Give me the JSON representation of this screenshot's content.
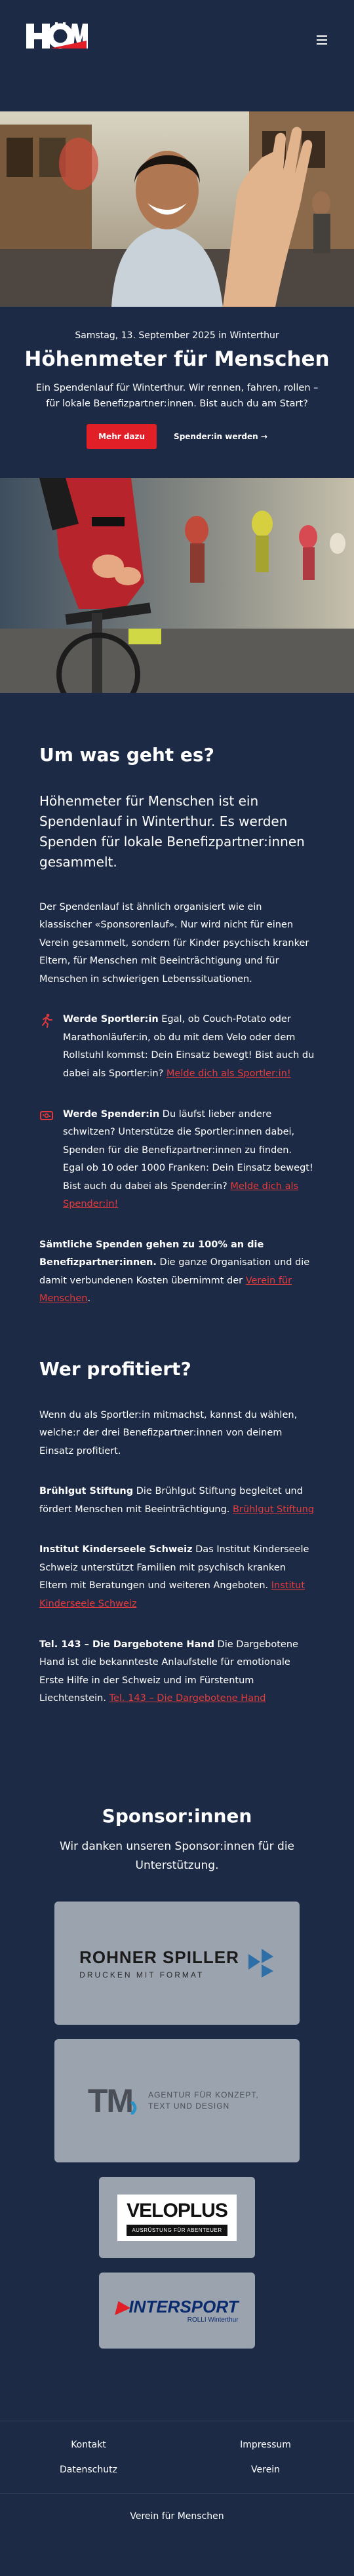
{
  "colors": {
    "background": "#1c2a45",
    "accent": "#e01f26",
    "card": "#9ba3ae"
  },
  "header": {
    "logo_text": "HÖM",
    "menu_icon": "hamburger-icon"
  },
  "hero": {
    "date": "Samstag, 13. September 2025 in Winterthur",
    "title": "Höhenmeter für Menschen",
    "subtitle": "Ein Spendenlauf für Winterthur. Wir rennen, fahren, rollen – für lokale Benefizpartner:innen. Bist auch du am Start?",
    "btn_more": "Mehr dazu",
    "btn_sponsor": "Spender:in werden →"
  },
  "about": {
    "title": "Um was geht es?",
    "lead": "Höhenmeter für Menschen ist ein Spendenlauf in Winterthur. Es werden Spenden für lokale Benefizpartner:innen gesammelt.",
    "text": "Der Spendenlauf ist ähnlich organisiert wie ein klassischer «Sponsorenlauf». Nur wird nicht für einen Verein gesammelt, sondern für Kinder psychisch kranker Eltern, für Menschen mit Beeinträchtigung und für Menschen in schwierigen Lebenssituationen.",
    "features": [
      {
        "icon": "runner-icon",
        "title": "Werde Sportler:in",
        "text": " Egal, ob Couch-Potato oder Marathonläufer:in, ob du mit dem Velo oder dem Rollstuhl kommst: Dein Einsatz bewegt! Bist auch du dabei als Sportler:in? ",
        "link": "Melde dich als Sportler:in!"
      },
      {
        "icon": "donation-icon",
        "title": "Werde Spender:in",
        "text": " Du läufst lieber andere schwitzen? Unterstütze die Sportler:innen dabei, Spenden für die Benefizpartner:innen zu finden. Egal ob 10 oder 1000 Franken: Dein Einsatz bewegt! Bist auch du dabei als Spender:in? ",
        "link": "Melde dich als Spender:in!"
      }
    ],
    "donation_strong": "Sämtliche Spenden gehen zu 100% an die Benefizpartner:innen.",
    "donation_text": " Die ganze Organisation und die damit verbundenen Kosten übernimmt der ",
    "donation_link": "Verein für Menschen",
    "donation_end": "."
  },
  "beneficiaries": {
    "title": "Wer profitiert?",
    "intro": "Wenn du als Sportler:in mitmachst, kannst du wählen, welche:r der drei Benefizpartner:innen von deinem Einsatz profitiert.",
    "items": [
      {
        "name": "Brühlgut Stiftung",
        "text": " Die Brühlgut Stiftung begleitet und fördert Menschen mit Beeinträchtigung. ",
        "link": "Brühlgut Stiftung"
      },
      {
        "name": "Institut Kinderseele Schweiz",
        "text": " Das Institut Kinderseele Schweiz unterstützt Familien mit psychisch kranken Eltern mit Beratungen und weiteren Angeboten. ",
        "link": "Institut Kinderseele Schweiz"
      },
      {
        "name": "Tel. 143 – Die Dargebotene Hand",
        "text": " Die Dargebotene Hand ist die bekannteste Anlaufstelle für emotionale Erste Hilfe in der Schweiz und im Fürstentum Liechtenstein. ",
        "link": "Tel. 143 – Die Dargebotene Hand"
      }
    ]
  },
  "sponsors": {
    "title": "Sponsor:innen",
    "subtitle": "Wir danken unseren Sponsor:innen für die Unterstützung.",
    "logos": [
      {
        "name": "ROHNER SPILLER",
        "tagline": "DRUCKEN MIT FORMAT"
      },
      {
        "name": "TM",
        "tagline": "AGENTUR FÜR KONZEPT, TEXT UND DESIGN"
      },
      {
        "name": "VELOPLUS",
        "tagline": "AUSRÜSTUNG FÜR ABENTEUER"
      },
      {
        "name": "INTERSPORT",
        "tagline": "ROLLI Winterthur"
      }
    ]
  },
  "footer": {
    "links": [
      "Kontakt",
      "Impressum",
      "Datenschutz",
      "Verein"
    ],
    "bottom": "Verein für Menschen"
  }
}
